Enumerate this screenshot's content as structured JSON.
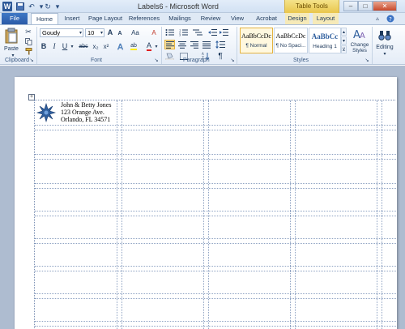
{
  "titlebar": {
    "title": "Labels6 - Microsoft Word",
    "contextual_tab_group": "Table Tools",
    "qat_icons": [
      "save-icon",
      "undo-icon",
      "redo-icon",
      "customize-qat-icon"
    ],
    "window_buttons": [
      "minimize-icon",
      "maximize-icon",
      "close-icon"
    ]
  },
  "tabs": {
    "file": "File",
    "home": "Home",
    "insert": "Insert",
    "page_layout": "Page Layout",
    "references": "References",
    "mailings": "Mailings",
    "review": "Review",
    "view": "View",
    "acrobat": "Acrobat",
    "design": "Design",
    "layout": "Layout",
    "active": "Home"
  },
  "ribbon": {
    "clipboard": {
      "label": "Clipboard",
      "paste": "Paste"
    },
    "font": {
      "label": "Font",
      "font_name": "Goudy",
      "font_size": "10",
      "bold": "B",
      "italic": "I",
      "underline": "U",
      "strike": "abc",
      "subscript": "x₂",
      "superscript": "x²",
      "grow": "A",
      "shrink": "A",
      "case": "Aa",
      "clear": "A",
      "color": "A",
      "highlight": "ab"
    },
    "paragraph": {
      "label": "Paragraph",
      "pilcrow": "¶"
    },
    "styles": {
      "label": "Styles",
      "items": [
        {
          "sample": "AaBbCcDc",
          "name": "¶ Normal"
        },
        {
          "sample": "AaBbCcDc",
          "name": "¶ No Spaci..."
        },
        {
          "sample": "AaBbCc",
          "name": "Heading 1"
        }
      ],
      "change_styles": "Change Styles"
    },
    "editing": {
      "label": "Editing"
    }
  },
  "document": {
    "label_address": {
      "line1": "John & Betty Jones",
      "line2": "123 Orange Ave.",
      "line3": "Orlando, FL 34571"
    },
    "logo_color": "#2f5f9e"
  }
}
